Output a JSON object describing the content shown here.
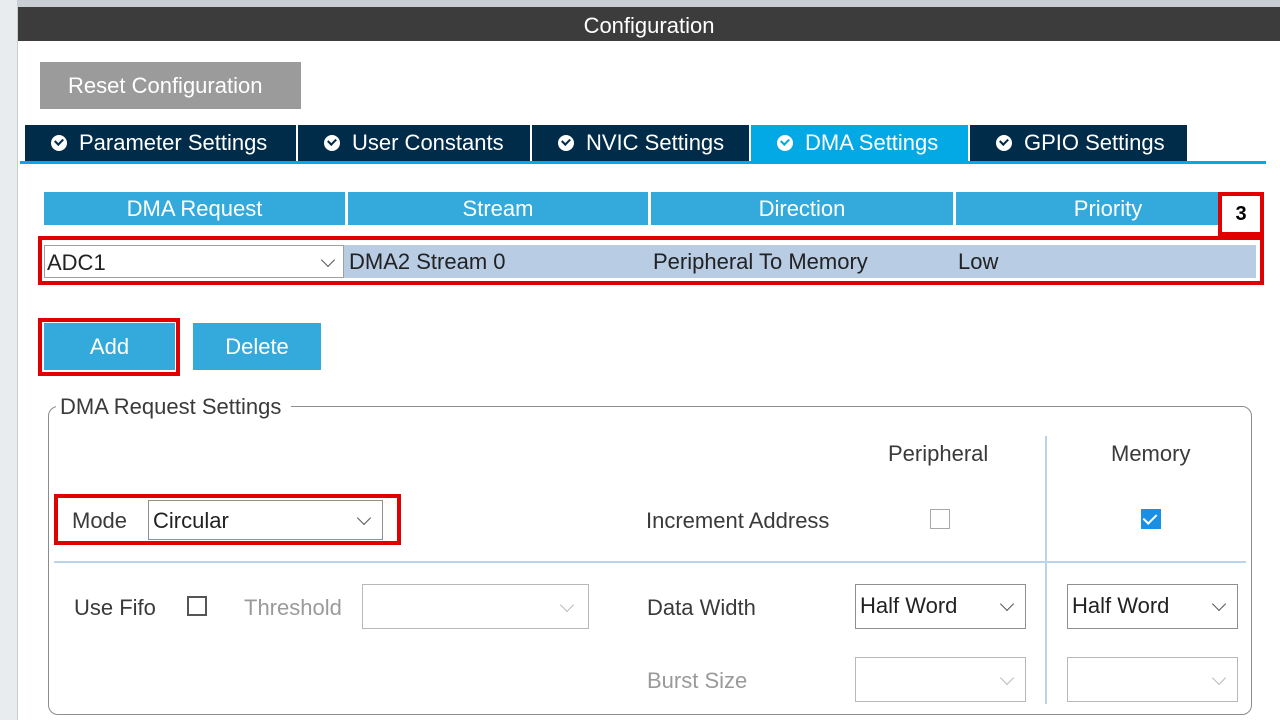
{
  "window": {
    "title": "Configuration"
  },
  "toolbar": {
    "reset_label": "Reset Configuration"
  },
  "tabs": [
    {
      "label": "Parameter Settings",
      "active": false
    },
    {
      "label": "User Constants",
      "active": false
    },
    {
      "label": "NVIC Settings",
      "active": false
    },
    {
      "label": "DMA Settings",
      "active": true
    },
    {
      "label": "GPIO Settings",
      "active": false
    }
  ],
  "dma_table": {
    "headers": [
      "DMA Request",
      "Stream",
      "Direction",
      "Priority"
    ],
    "rows": [
      {
        "request": "ADC1",
        "stream": "DMA2 Stream 0",
        "direction": "Peripheral To Memory",
        "priority": "Low"
      }
    ]
  },
  "step_badge": "3",
  "actions": {
    "add_label": "Add",
    "delete_label": "Delete"
  },
  "request_settings": {
    "legend": "DMA Request Settings",
    "peripheral_header": "Peripheral",
    "memory_header": "Memory",
    "mode_label": "Mode",
    "mode_value": "Circular",
    "increment_label": "Increment Address",
    "peripheral_increment": false,
    "memory_increment": true,
    "use_fifo_label": "Use Fifo",
    "use_fifo": false,
    "threshold_label": "Threshold",
    "threshold_value": "",
    "data_width_label": "Data Width",
    "peripheral_data_width": "Half Word",
    "memory_data_width": "Half Word",
    "burst_size_label": "Burst Size",
    "peripheral_burst_size": "",
    "memory_burst_size": ""
  },
  "colors": {
    "tab_bg": "#002b49",
    "tab_active": "#03a9e4",
    "header_bg": "#34aadc",
    "highlight": "#e00000",
    "row_bg": "#b8cce4"
  }
}
